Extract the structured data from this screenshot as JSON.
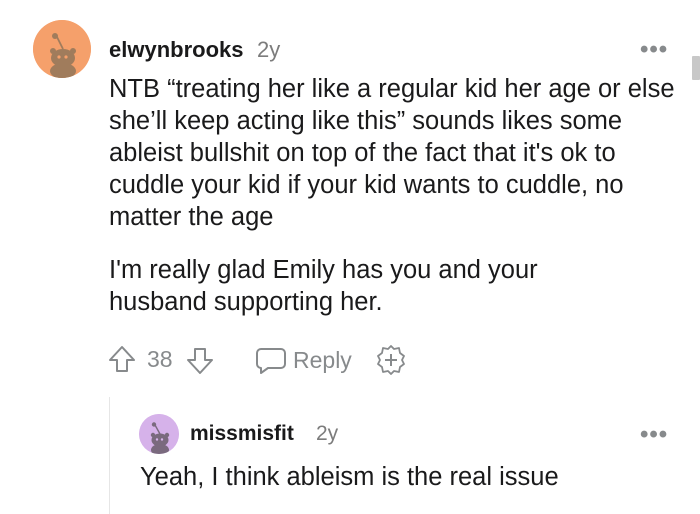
{
  "colors": {
    "avatar_main_bg": "#f5a06b",
    "avatar_reply_bg": "#d6b2ea",
    "text": "#1a1a1b",
    "meta": "#7c7c7c",
    "icon": "#878a8c"
  },
  "comment": {
    "username": "elwynbrooks",
    "age": "2y",
    "menu": "•••",
    "paragraphs": [
      "NTB “treating her like a regular kid her age or else she’ll keep acting like this” sounds likes some ableist bullshit on top of the fact that it's ok to cuddle your kid if your kid wants to cuddle, no matter the age",
      "I'm really glad Emily has you and your husband supporting her."
    ],
    "votes": "38",
    "reply_label": "Reply",
    "icons": [
      "upvote-icon",
      "downvote-icon",
      "reply-bubble-icon",
      "award-icon",
      "more-options-icon"
    ]
  },
  "reply": {
    "username": "missmisfit",
    "age": "2y",
    "menu": "•••",
    "text": "Yeah, I think ableism is the real issue"
  }
}
